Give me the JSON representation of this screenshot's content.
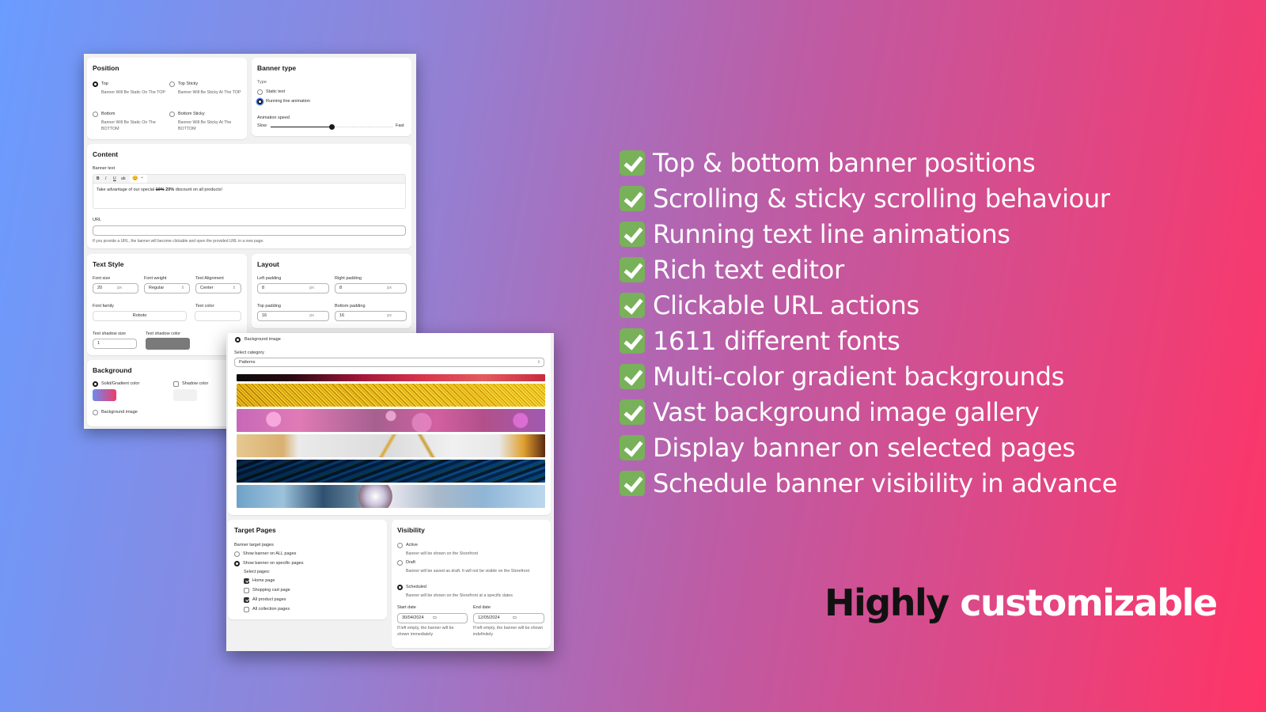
{
  "settings_screenshot": {
    "position": {
      "title": "Position",
      "options": [
        {
          "label": "Top",
          "description": "Banner Will Be Static On The TOP",
          "selected": true
        },
        {
          "label": "Top Sticky",
          "description": "Banner Will Be Sticky At The TOP",
          "selected": false
        },
        {
          "label": "Bottom",
          "description": "Banner Will Be Static On The BOTTOM",
          "selected": false
        },
        {
          "label": "Bottom Sticky",
          "description": "Banner Will Be Sticky At The BOTTOM",
          "selected": false
        }
      ]
    },
    "banner_type": {
      "title": "Banner type",
      "type_label": "Type",
      "options": [
        {
          "label": "Static text",
          "selected": false
        },
        {
          "label": "Running line animation",
          "selected": true
        }
      ],
      "speed_label": "Animation speed",
      "speed_min_label": "Slow",
      "speed_max_label": "Fast",
      "speed_value_fraction": 0.45
    },
    "content": {
      "title": "Content",
      "banner_text_label": "Banner text",
      "toolbar": {
        "bold": "B",
        "italic": "I",
        "underline": "U",
        "strike": "ab",
        "emoji": "😊",
        "emoji_caret": "⌄"
      },
      "text_before": "Take advantage of our special ",
      "text_strike": "10%",
      "text_bold": " 20%",
      "text_after": " discount on all products!",
      "url_label": "URL",
      "url_value": "",
      "url_help": "If you provide a URL, the banner will become clickable and open the provided URL in a new page."
    },
    "text_style": {
      "title": "Text Style",
      "font_size_label": "Font size",
      "font_size_value": "20",
      "font_size_unit": "px",
      "font_weight_label": "Font weight",
      "font_weight_value": "Regular",
      "alignment_label": "Text Alignment",
      "alignment_value": "Center",
      "font_family_label": "Font family",
      "font_family_value": "Roboto",
      "text_color_label": "Text color",
      "text_color_value": "#ffffff",
      "shadow_size_label": "Text shadow size",
      "shadow_size_value": "1",
      "shadow_color_label": "Text shadow color",
      "shadow_color_value": "#7a7a7a"
    },
    "layout": {
      "title": "Layout",
      "left_padding_label": "Left padding",
      "left_padding_value": "8",
      "right_padding_label": "Right padding",
      "right_padding_value": "8",
      "top_padding_label": "Top padding",
      "top_padding_value": "16",
      "bottom_padding_label": "Bottom padding",
      "bottom_padding_value": "16",
      "unit": "px"
    },
    "background": {
      "title": "Background",
      "solid_label": "Solid/Gradient color",
      "solid_selected": true,
      "gradient_from": "#6a8cf0",
      "gradient_to": "#ef3b6a",
      "shadow_label": "Shadow color",
      "shadow_checked": false,
      "shadow_value": "#f1f1f1",
      "image_label": "Background image",
      "image_selected": false
    }
  },
  "gallery_screenshot": {
    "background_image_label": "Background image",
    "background_image_selected": true,
    "category_label": "Select category",
    "category_value": "Patterns",
    "images": [
      "dark-red-bokeh",
      "gold-glitter",
      "pink-bokeh",
      "white-gold-marble",
      "blue-gold-agate",
      "blue-crystal-pearl"
    ],
    "target_pages": {
      "title": "Target Pages",
      "label": "Banner target pages",
      "options": [
        {
          "label": "Show banner on ALL pages",
          "selected": false
        },
        {
          "label": "Show banner on specific pages",
          "selected": true
        }
      ],
      "select_label": "Select pages:",
      "pages": [
        {
          "label": "Home page",
          "checked": true
        },
        {
          "label": "Shopping cart page",
          "checked": false
        },
        {
          "label": "All product pages",
          "checked": true
        },
        {
          "label": "All collection pages",
          "checked": false
        }
      ]
    },
    "visibility": {
      "title": "Visibility",
      "options": [
        {
          "label": "Active",
          "description": "Banner will be shown on the Storefront",
          "selected": false
        },
        {
          "label": "Draft",
          "description": "Banner will be saved as draft. It will not be visible on the Storefront",
          "selected": false
        },
        {
          "label": "Scheduled",
          "description": "Banner will be shown on the Storefront at a specific dates",
          "selected": true
        }
      ],
      "start_label": "Start date",
      "start_value": "30/04/2024",
      "start_help": "If left empty, the banner will be shown immediately",
      "end_label": "End date",
      "end_value": "12/05/2024",
      "end_help": "If left empty, the banner will be shown indefinitely"
    }
  },
  "features": [
    "Top & bottom banner positions",
    "Scrolling & sticky scrolling behaviour",
    "Running text line animations",
    "Rich text editor",
    "Clickable URL actions",
    "1611 different fonts",
    "Multi-color gradient backgrounds",
    "Vast background image gallery",
    "Display banner on selected pages",
    "Schedule banner visibility in advance"
  ],
  "tagline": {
    "dark": "Highly",
    "light": " customizable"
  },
  "colors": {
    "bg_start": "#6a9cff",
    "bg_end": "#ff3466",
    "check_green": "#78b159"
  }
}
